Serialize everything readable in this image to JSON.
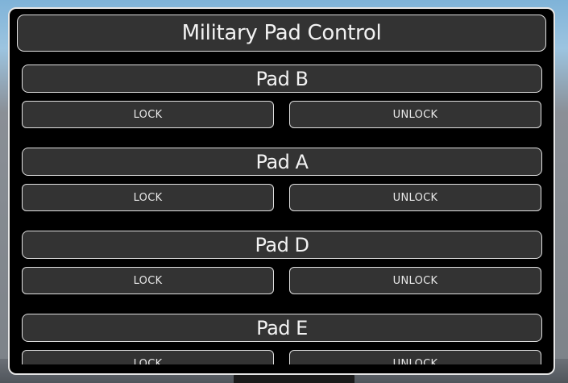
{
  "panel": {
    "title": "Military Pad Control"
  },
  "pads": [
    {
      "name": "Pad B",
      "lock_label": "LOCK",
      "unlock_label": "UNLOCK"
    },
    {
      "name": "Pad A",
      "lock_label": "LOCK",
      "unlock_label": "UNLOCK"
    },
    {
      "name": "Pad D",
      "lock_label": "LOCK",
      "unlock_label": "UNLOCK"
    },
    {
      "name": "Pad E",
      "lock_label": "LOCK",
      "unlock_label": "UNLOCK"
    }
  ]
}
